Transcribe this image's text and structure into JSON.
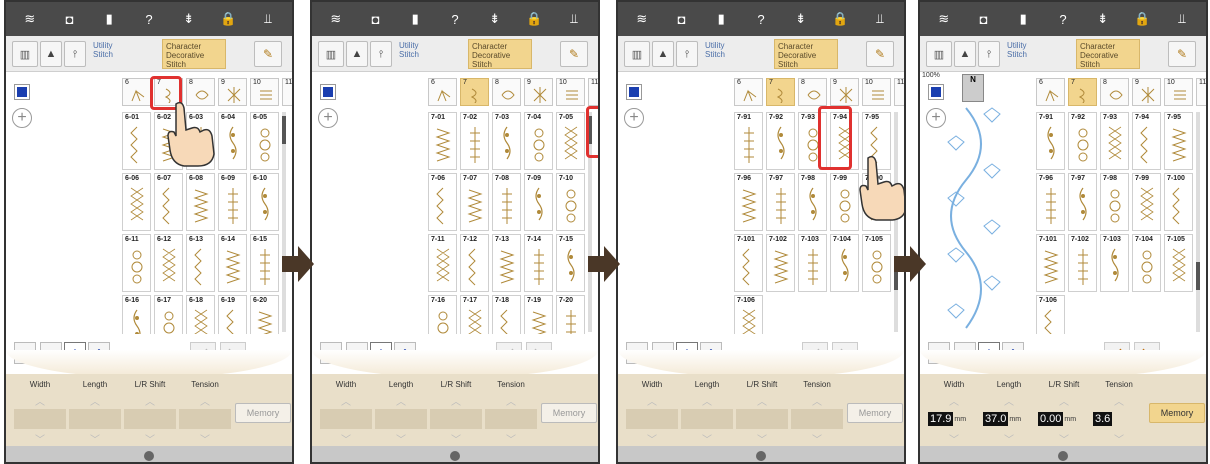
{
  "panels": [
    {
      "categories": [
        "6",
        "7",
        "8",
        "9",
        "10",
        "11"
      ],
      "selected_category": "6",
      "stitches": [
        "6-01",
        "6-02",
        "6-03",
        "6-04",
        "6-05",
        "6-06",
        "6-07",
        "6-08",
        "6-09",
        "6-10",
        "6-11",
        "6-12",
        "6-13",
        "6-14",
        "6-15",
        "6-16",
        "6-17",
        "6-18",
        "6-19",
        "6-20"
      ],
      "step_desc": "tap category 7"
    },
    {
      "categories": [
        "6",
        "7",
        "8",
        "9",
        "10",
        "11"
      ],
      "selected_category": "7",
      "stitches": [
        "7-01",
        "7-02",
        "7-03",
        "7-04",
        "7-05",
        "7-06",
        "7-07",
        "7-08",
        "7-09",
        "7-10",
        "7-11",
        "7-12",
        "7-13",
        "7-14",
        "7-15",
        "7-16",
        "7-17",
        "7-18",
        "7-19",
        "7-20"
      ],
      "step_desc": "scroll"
    },
    {
      "categories": [
        "6",
        "7",
        "8",
        "9",
        "10",
        "11"
      ],
      "selected_category": "7",
      "stitches": [
        "7-91",
        "7-92",
        "7-93",
        "7-94",
        "7-95",
        "7-96",
        "7-97",
        "7-98",
        "7-99",
        "7-100",
        "7-101",
        "7-102",
        "7-103",
        "7-104",
        "7-105",
        "7-106"
      ],
      "step_desc": "tap 7-94"
    },
    {
      "categories": [
        "6",
        "7",
        "8",
        "9",
        "10",
        "11"
      ],
      "selected_category": "7",
      "stitches": [
        "7-91",
        "7-92",
        "7-93",
        "7-94",
        "7-95",
        "7-96",
        "7-97",
        "7-98",
        "7-99",
        "7-100",
        "7-101",
        "7-102",
        "7-103",
        "7-104",
        "7-105",
        "7-106"
      ],
      "step_desc": "selected"
    }
  ],
  "tabs": {
    "utility": "Utility\nStitch",
    "character": "Character\nDecorative\nStitch"
  },
  "controls": {
    "width": "Width",
    "length": "Length",
    "lr_shift": "L/R Shift",
    "tension": "Tension",
    "memory": "Memory"
  },
  "values": {
    "width": "17.9",
    "width_unit": "mm",
    "length": "37.0",
    "length_unit": "mm",
    "lr_shift": "0.00",
    "lr_unit": "mm",
    "tension": "3.6"
  },
  "zoom": "100%",
  "foot_label": "N",
  "colors": {
    "accent": "#f2d58e",
    "highlight": "#e0312f",
    "blue": "#1b3fb0",
    "stitch": "#b08a3a",
    "preview": "#7ab0e0"
  }
}
